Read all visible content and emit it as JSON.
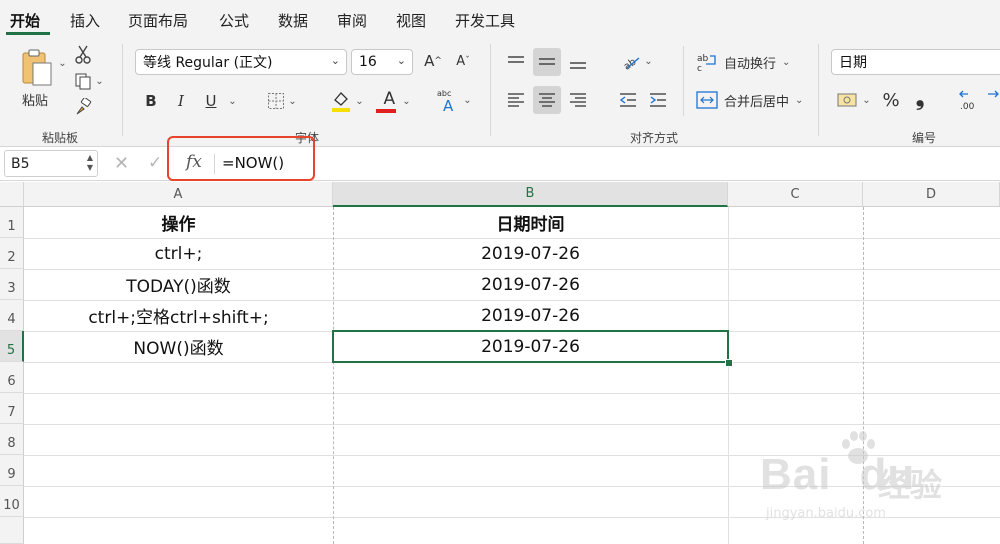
{
  "ribbon_tabs": [
    "开始",
    "插入",
    "页面布局",
    "公式",
    "数据",
    "审阅",
    "视图",
    "开发工具"
  ],
  "clipboard": {
    "paste_label": "粘贴",
    "group_label": "粘贴板"
  },
  "font": {
    "family": "等线 Regular (正文)",
    "size": "16",
    "group_label": "字体",
    "bold": "B",
    "italic": "I",
    "underline": "U",
    "font_color": "A"
  },
  "alignment": {
    "wrap_text": "自动换行",
    "merge_center": "合并后居中",
    "group_label": "对齐方式"
  },
  "number": {
    "format": "日期",
    "percent": "%",
    "comma": "❟",
    "group_label": "编号"
  },
  "formula_bar": {
    "name_box": "B5",
    "fx": "fx",
    "formula": "=NOW()"
  },
  "columns": [
    "A",
    "B",
    "C",
    "D"
  ],
  "rows": [
    "1",
    "2",
    "3",
    "4",
    "5",
    "6",
    "7",
    "8",
    "9",
    "10"
  ],
  "cells": [
    {
      "a": "操作",
      "b": "日期时间"
    },
    {
      "a": "ctrl+;",
      "b": "2019-07-26"
    },
    {
      "a": "TODAY()函数",
      "b": "2019-07-26"
    },
    {
      "a": "ctrl+;空格ctrl+shift+;",
      "b": "2019-07-26"
    },
    {
      "a": "NOW()函数",
      "b": "2019-07-26"
    }
  ],
  "selected_cell": "B5",
  "watermark": {
    "brand": "Bai",
    "brand_suffix": "du",
    "cn": "经验",
    "url": "jingyan.baidu.com"
  },
  "colors": {
    "accent": "#217346",
    "highlight": "#e8442b",
    "font_color_bar": "#e02020",
    "fill_color_bar": "#f5e000"
  }
}
